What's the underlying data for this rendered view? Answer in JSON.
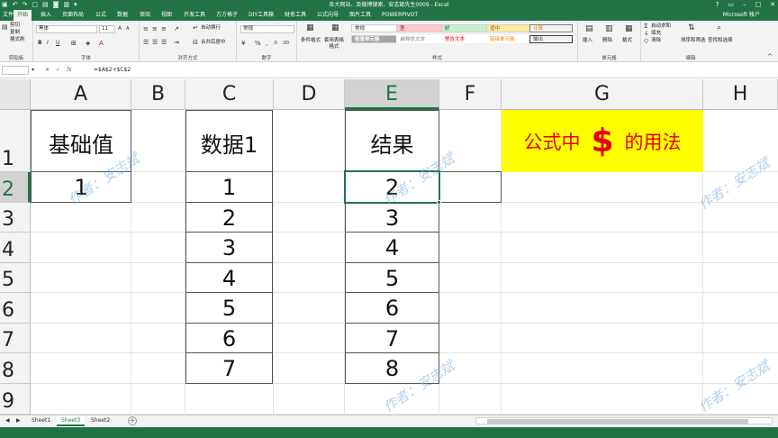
{
  "window": {
    "title": "各大网站、及微博搜索、安志斌先生0009 - Excel"
  },
  "ribbon_tabs": [
    "开始",
    "插入",
    "页面布局",
    "公式",
    "数据",
    "审阅",
    "视图",
    "开发工具",
    "方方格子",
    "DIY工具箱",
    "财务工具",
    "公式向导",
    "图片工具",
    "POWERPIVOT"
  ],
  "account": "Microsoft 帐户",
  "ribbon": {
    "clipboard": {
      "cut": "剪切",
      "copy": "复制",
      "format_painter": "格式刷",
      "label": "剪贴板"
    },
    "font": {
      "name": "黑体",
      "size": "11",
      "label": "字体",
      "bold": "B",
      "italic": "I",
      "underline": "U"
    },
    "alignment": {
      "wrap": "自动换行",
      "merge": "合并后居中",
      "label": "对齐方式"
    },
    "number": {
      "format": "常规",
      "label": "数字"
    },
    "styles": {
      "conditional": "条件格式",
      "table_format": "套用表格格式",
      "cells": [
        "常规",
        "差",
        "好",
        "适中",
        "计算",
        "检查单元格",
        "解释性文本",
        "警告文本",
        "链接单元格",
        "输出"
      ],
      "label": "样式"
    },
    "cells_group": {
      "insert": "插入",
      "delete": "删除",
      "format": "格式",
      "label": "单元格"
    },
    "editing": {
      "autosum": "自动求和",
      "fill": "填充",
      "clear": "清除",
      "sort": "排序和筛选",
      "find": "查找和选择",
      "label": "编辑"
    }
  },
  "formula_bar": {
    "name_box": "",
    "formula": "=$A$2+$C$2"
  },
  "columns": [
    "A",
    "B",
    "C",
    "D",
    "E",
    "F",
    "G",
    "H"
  ],
  "selected_column": "E",
  "rows": [
    "1",
    "2",
    "3",
    "4",
    "5",
    "6",
    "7",
    "8",
    "9"
  ],
  "selected_row": "2",
  "cells": {
    "A1": "基础值",
    "A2": "1",
    "C1": "数据1",
    "C_values": [
      "1",
      "2",
      "3",
      "4",
      "5",
      "6",
      "7"
    ],
    "E1": "结果",
    "E_values": [
      "2",
      "3",
      "4",
      "5",
      "6",
      "7",
      "8"
    ],
    "G1_pre": "公式中",
    "G1_dollar": "$",
    "G1_post": "的用法"
  },
  "watermark": "作者：安志斌",
  "sheets": [
    "Sheet1",
    "Sheet3",
    "Sheet2"
  ],
  "active_sheet": "Sheet3",
  "colors": {
    "excel_green": "#217346",
    "highlight_yellow": "#ffff00",
    "title_red": "#e60000"
  }
}
